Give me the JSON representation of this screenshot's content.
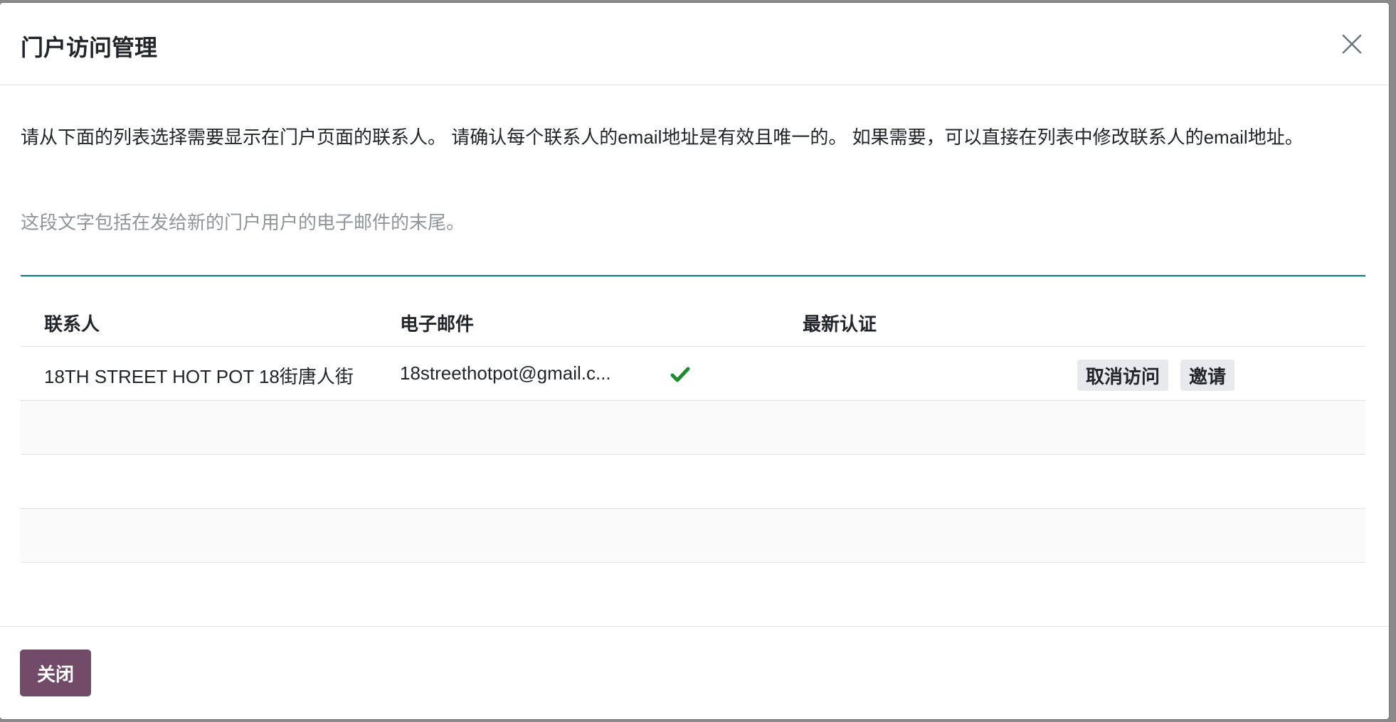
{
  "dialog": {
    "title": "门户访问管理",
    "intro": "请从下面的列表选择需要显示在门户页面的联系人。 请确认每个联系人的email地址是有效且唯一的。 如果需要，可以直接在列表中修改联系人的email地址。",
    "welcome_placeholder": "这段文字包括在发给新的门户用户的电子邮件的末尾。",
    "welcome_value": ""
  },
  "table": {
    "headers": {
      "contact": "联系人",
      "email": "电子邮件",
      "latest_auth": "最新认证"
    },
    "rows": [
      {
        "contact": "18TH STREET HOT POT 18街唐人街",
        "email": "18streethotpot@gmail.c...",
        "email_valid_icon": "check-icon",
        "latest_auth": "",
        "revoke_label": "取消访问",
        "invite_label": "邀请"
      }
    ]
  },
  "footer": {
    "close_label": "关闭"
  },
  "colors": {
    "primary": "#714b67",
    "accent_underline": "#017e84",
    "check_green": "#28a745",
    "secondary_btn_bg": "#e7e9ed"
  }
}
